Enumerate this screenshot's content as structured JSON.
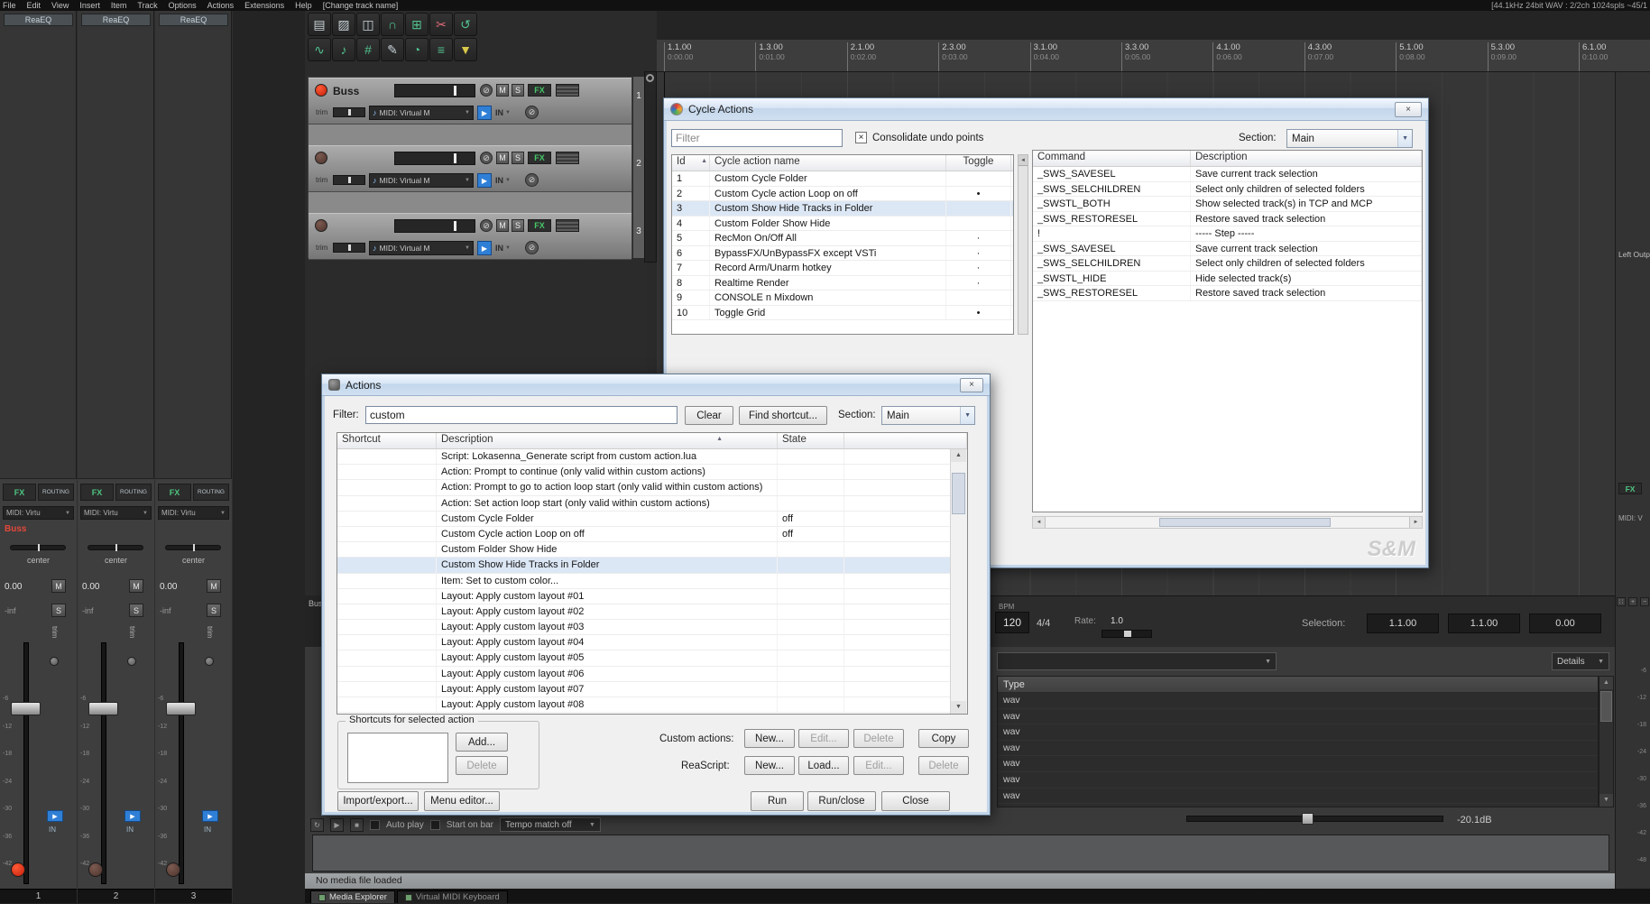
{
  "glyphs": {
    "close": "×",
    "dropdown": "▼",
    "sort": "▲",
    "left_arrow": "◄",
    "right_arrow": "►",
    "up": "▲",
    "down": "▼",
    "play": "▶",
    "stop": "■",
    "repeat": "↻",
    "note": "♪",
    "phase": "⊘",
    "dots": "∷",
    "plus": "+",
    "minus": "−",
    "check": "×"
  },
  "menubar": {
    "items": [
      "File",
      "Edit",
      "View",
      "Insert",
      "Item",
      "Track",
      "Options",
      "Actions",
      "Extensions",
      "Help",
      "[Change track name]"
    ],
    "status_right": "[44.1kHz 24bit WAV : 2/2ch 1024spls ~45/1"
  },
  "toolbar": {
    "row1": [
      {
        "name": "new-project",
        "glyph": "▤",
        "color": "#c9d4d9"
      },
      {
        "name": "open-project",
        "glyph": "▨",
        "color": "#c9d4d9"
      },
      {
        "name": "save-project",
        "glyph": "◫",
        "color": "#c9d4d9"
      },
      {
        "name": "snap-toggle",
        "glyph": "∩",
        "color": "#52c08e"
      },
      {
        "name": "grid-toggle",
        "glyph": "⊞",
        "color": "#52c08e"
      },
      {
        "name": "marquee-tool",
        "glyph": "✂",
        "color": "#e06a78"
      },
      {
        "name": "loop-toggle",
        "glyph": "↺",
        "color": "#52c08e"
      }
    ],
    "row2": [
      {
        "name": "envelope-toggle",
        "glyph": "∿",
        "color": "#52c08e"
      },
      {
        "name": "midi-editor",
        "glyph": "♪",
        "color": "#52c08e"
      },
      {
        "name": "grid-settings",
        "glyph": "#",
        "color": "#52c08e"
      },
      {
        "name": "pencil-tool",
        "glyph": "✎",
        "color": "#c9d4d9"
      },
      {
        "name": "metronome-toggle",
        "glyph": "◔",
        "color": "#52c08e"
      },
      {
        "name": "group-toggle",
        "glyph": "≡",
        "color": "#52c08e"
      },
      {
        "name": "filter-tool",
        "glyph": "▼",
        "color": "#d8c84a"
      }
    ]
  },
  "tcp": {
    "tracks": [
      {
        "number": "1",
        "name": "Buss",
        "armed": true,
        "mute": "M",
        "solo": "S",
        "fx": "FX",
        "trim_label": "trim",
        "midi_input": "MIDI: Virtual M",
        "in_label": "IN"
      },
      {
        "number": "2",
        "name": "",
        "armed": false,
        "mute": "M",
        "solo": "S",
        "fx": "FX",
        "trim_label": "trim",
        "midi_input": "MIDI: Virtual M",
        "in_label": "IN"
      },
      {
        "number": "3",
        "name": "",
        "armed": false,
        "mute": "M",
        "solo": "S",
        "fx": "FX",
        "trim_label": "trim",
        "midi_input": "MIDI: Virtual M",
        "in_label": "IN"
      }
    ]
  },
  "ruler": {
    "marks": [
      {
        "bar": "1.1.00",
        "time": "0:00.00"
      },
      {
        "bar": "1.3.00",
        "time": "0:01.00"
      },
      {
        "bar": "2.1.00",
        "time": "0:02.00"
      },
      {
        "bar": "2.3.00",
        "time": "0:03.00"
      },
      {
        "bar": "3.1.00",
        "time": "0:04.00"
      },
      {
        "bar": "3.3.00",
        "time": "0:05.00"
      },
      {
        "bar": "4.1.00",
        "time": "0:06.00"
      },
      {
        "bar": "4.3.00",
        "time": "0:07.00"
      },
      {
        "bar": "5.1.00",
        "time": "0:08.00"
      },
      {
        "bar": "5.3.00",
        "time": "0:09.00"
      },
      {
        "bar": "6.1.00",
        "time": "0:10.00"
      }
    ]
  },
  "mixer": {
    "fx_insert_label": "ReaEQ",
    "db_marks": [
      "-6",
      "-12",
      "-18",
      "-24",
      "-30",
      "-36",
      "-42",
      "-48"
    ],
    "labels": {
      "fx": "FX",
      "routing": "ROUTING",
      "midi": "MIDI: Virtu",
      "pan": "center",
      "vol": "0.00",
      "peak": "-inf",
      "mute": "M",
      "solo": "S",
      "trim": "trim",
      "in": "IN"
    },
    "strips": [
      {
        "number": "1",
        "name": "Buss",
        "armed": true
      },
      {
        "number": "2",
        "name": "",
        "armed": false
      },
      {
        "number": "3",
        "name": "",
        "armed": false
      }
    ]
  },
  "right_strip": {
    "output_label": "Left Outp",
    "fx": "FX",
    "midi": "MIDI: V",
    "db_marks": [
      "-6",
      "-12",
      "-18",
      "-24",
      "-30",
      "-36",
      "-42",
      "-48"
    ]
  },
  "transport": {
    "bpm_label": "BPM",
    "bpm_value": "120",
    "time_signature": "4/4",
    "rate_label": "Rate:",
    "rate_value": "1.0",
    "selection_label": "Selection:",
    "selection_start": "1.1.00",
    "selection_end": "1.1.00",
    "selection_length": "0.00"
  },
  "cycle_dialog": {
    "title": "Cycle Actions",
    "filter_placeholder": "Filter",
    "consolidate_label": "Consolidate undo points",
    "section_label": "Section:",
    "section_value": "Main",
    "left_list": {
      "headers": [
        "Id",
        "Cycle action name",
        "Toggle"
      ],
      "selected_index": 2,
      "rows": [
        {
          "id": "1",
          "name": "Custom Cycle Folder",
          "toggle": ""
        },
        {
          "id": "2",
          "name": "Custom Cycle action Loop on off",
          "toggle": "•"
        },
        {
          "id": "3",
          "name": "Custom Show Hide Tracks in Folder",
          "toggle": ""
        },
        {
          "id": "4",
          "name": "Custom Folder Show Hide",
          "toggle": ""
        },
        {
          "id": "5",
          "name": "RecMon On/Off All",
          "toggle": "·"
        },
        {
          "id": "6",
          "name": "BypassFX/UnBypassFX except VSTi",
          "toggle": "·"
        },
        {
          "id": "7",
          "name": "Record Arm/Unarm hotkey",
          "toggle": "·"
        },
        {
          "id": "8",
          "name": "Realtime Render",
          "toggle": "·"
        },
        {
          "id": "9",
          "name": "CONSOLE n Mixdown",
          "toggle": ""
        },
        {
          "id": "10",
          "name": "Toggle Grid",
          "toggle": "•"
        }
      ]
    },
    "right_list": {
      "headers": [
        "Command",
        "Description"
      ],
      "rows": [
        {
          "command": "_SWS_SAVESEL",
          "description": "Save current track selection"
        },
        {
          "command": "_SWS_SELCHILDREN",
          "description": "Select only children of selected folders"
        },
        {
          "command": "_SWSTL_BOTH",
          "description": "Show selected track(s) in TCP and MCP"
        },
        {
          "command": "_SWS_RESTORESEL",
          "description": "Restore saved track selection"
        },
        {
          "command": "!",
          "description": "----- Step -----"
        },
        {
          "command": "_SWS_SAVESEL",
          "description": "Save current track selection"
        },
        {
          "command": "_SWS_SELCHILDREN",
          "description": "Select only children of selected folders"
        },
        {
          "command": "_SWSTL_HIDE",
          "description": "Hide selected track(s)"
        },
        {
          "command": "_SWS_RESTORESEL",
          "description": "Restore saved track selection"
        }
      ]
    },
    "watermark": "S&M"
  },
  "actions_dialog": {
    "title": "Actions",
    "filter_label": "Filter:",
    "filter_value": "custom",
    "clear_button": "Clear",
    "find_shortcut_button": "Find shortcut...",
    "section_label": "Section:",
    "section_value": "Main",
    "list": {
      "headers": [
        "Shortcut",
        "Description",
        "State"
      ],
      "selected_index": 7,
      "rows": [
        {
          "shortcut": "",
          "description": "Script: Lokasenna_Generate script from custom action.lua",
          "state": ""
        },
        {
          "shortcut": "",
          "description": "Action: Prompt to continue (only valid within custom actions)",
          "state": ""
        },
        {
          "shortcut": "",
          "description": "Action: Prompt to go to action loop start (only valid within custom actions)",
          "state": ""
        },
        {
          "shortcut": "",
          "description": "Action: Set action loop start (only valid within custom actions)",
          "state": ""
        },
        {
          "shortcut": "",
          "description": "Custom Cycle Folder",
          "state": "off"
        },
        {
          "shortcut": "",
          "description": "Custom Cycle action Loop on off",
          "state": "off"
        },
        {
          "shortcut": "",
          "description": "Custom Folder Show Hide",
          "state": ""
        },
        {
          "shortcut": "",
          "description": "Custom Show Hide Tracks in Folder",
          "state": ""
        },
        {
          "shortcut": "",
          "description": "Item: Set to custom color...",
          "state": ""
        },
        {
          "shortcut": "",
          "description": "Layout: Apply custom layout #01",
          "state": ""
        },
        {
          "shortcut": "",
          "description": "Layout: Apply custom layout #02",
          "state": ""
        },
        {
          "shortcut": "",
          "description": "Layout: Apply custom layout #03",
          "state": ""
        },
        {
          "shortcut": "",
          "description": "Layout: Apply custom layout #04",
          "state": ""
        },
        {
          "shortcut": "",
          "description": "Layout: Apply custom layout #05",
          "state": ""
        },
        {
          "shortcut": "",
          "description": "Layout: Apply custom layout #06",
          "state": ""
        },
        {
          "shortcut": "",
          "description": "Layout: Apply custom layout #07",
          "state": ""
        },
        {
          "shortcut": "",
          "description": "Layout: Apply custom layout #08",
          "state": ""
        }
      ]
    },
    "shortcuts_group": {
      "label": "Shortcuts for selected action",
      "add_button": "Add...",
      "delete_button": "Delete"
    },
    "custom_actions_label": "Custom actions:",
    "custom_actions_buttons": [
      {
        "label": "New...",
        "disabled": false
      },
      {
        "label": "Edit...",
        "disabled": true
      },
      {
        "label": "Delete",
        "disabled": true
      },
      {
        "label": "Copy",
        "disabled": false
      }
    ],
    "reascript_label": "ReaScript:",
    "reascript_buttons": [
      {
        "label": "New...",
        "disabled": false
      },
      {
        "label": "Load...",
        "disabled": false
      },
      {
        "label": "Edit...",
        "disabled": true
      },
      {
        "label": "Delete",
        "disabled": true
      }
    ],
    "import_export_button": "Import/export...",
    "menu_editor_button": "Menu editor...",
    "run_button": "Run",
    "run_close_button": "Run/close",
    "close_button": "Close"
  },
  "media_explorer": {
    "type_header": "Type",
    "files": [
      "wav",
      "wav",
      "wav",
      "wav",
      "wav",
      "wav",
      "wav"
    ],
    "details_label": "Details",
    "volume_db": "-20.1dB",
    "status": "No media file loaded",
    "auto_play_label": "Auto play",
    "start_on_bar_label": "Start on bar",
    "tempo_match_label": "Tempo match off"
  },
  "docker": {
    "tabs": [
      {
        "label": "Media Explorer",
        "active": true
      },
      {
        "label": "Virtual MIDI Keyboard",
        "active": false
      }
    ]
  },
  "misc": {
    "dock_track_label": "Buss"
  }
}
